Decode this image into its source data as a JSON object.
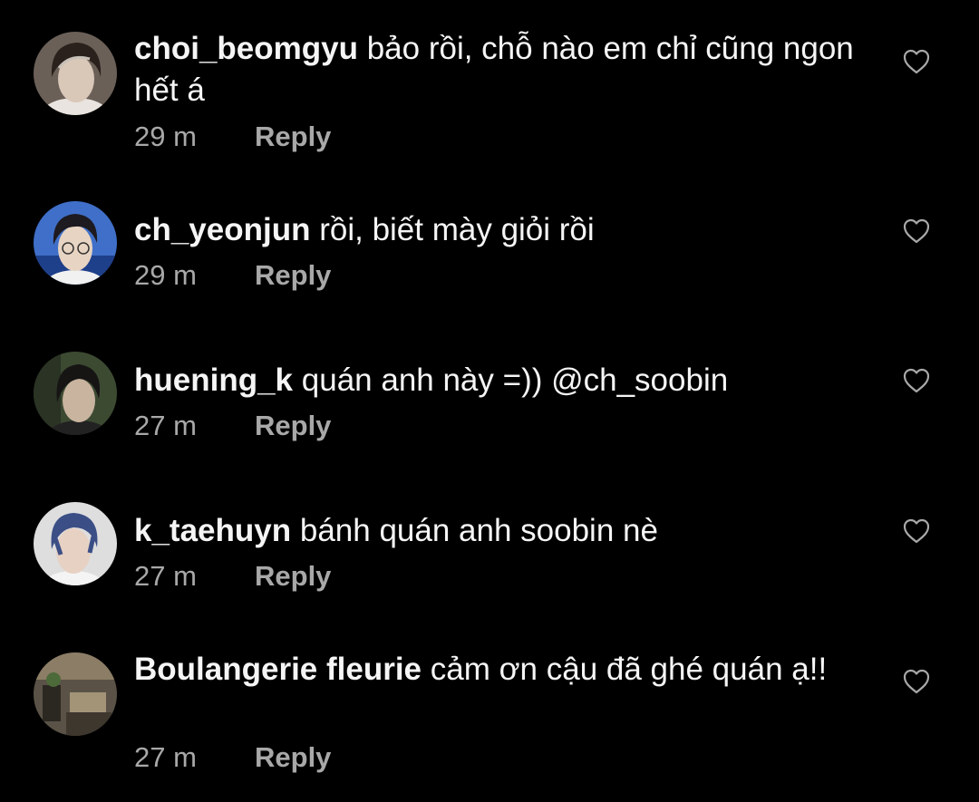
{
  "comments": [
    {
      "username": "choi_beomgyu",
      "text": "bảo rồi, chỗ nào em chỉ cũng ngon hết á",
      "time": "29 m",
      "reply_label": "Reply",
      "avatar_colors": [
        "#6b6058",
        "#d9c7b8",
        "#2a211c"
      ]
    },
    {
      "username": "ch_yeonjun",
      "text": "rồi, biết mày giỏi rồi",
      "time": "29 m",
      "reply_label": "Reply",
      "avatar_colors": [
        "#3f6fc8",
        "#e8d4c2",
        "#1d1a20"
      ]
    },
    {
      "username": "huening_k",
      "text": "quán anh này =)) @ch_soobin",
      "time": "27 m",
      "reply_label": "Reply",
      "avatar_colors": [
        "#3c4a32",
        "#c9b49f",
        "#161514"
      ]
    },
    {
      "username": "k_taehuyn",
      "text": "bánh quán anh soobin nè",
      "time": "27 m",
      "reply_label": "Reply",
      "avatar_colors": [
        "#dedede",
        "#e7d1c3",
        "#3b4f86"
      ]
    },
    {
      "username": "Boulangerie fleurie",
      "text": "cảm ơn cậu đã ghé quán ạ!!",
      "time": "27 m",
      "reply_label": "Reply",
      "avatar_colors": [
        "#5a5246",
        "#8c7d66",
        "#2b2822"
      ]
    }
  ],
  "icons": {
    "like": "heart-outline-icon"
  },
  "colors": {
    "background": "#000000",
    "primary_text": "#f5f5f5",
    "secondary_text": "#a8a8a8"
  }
}
